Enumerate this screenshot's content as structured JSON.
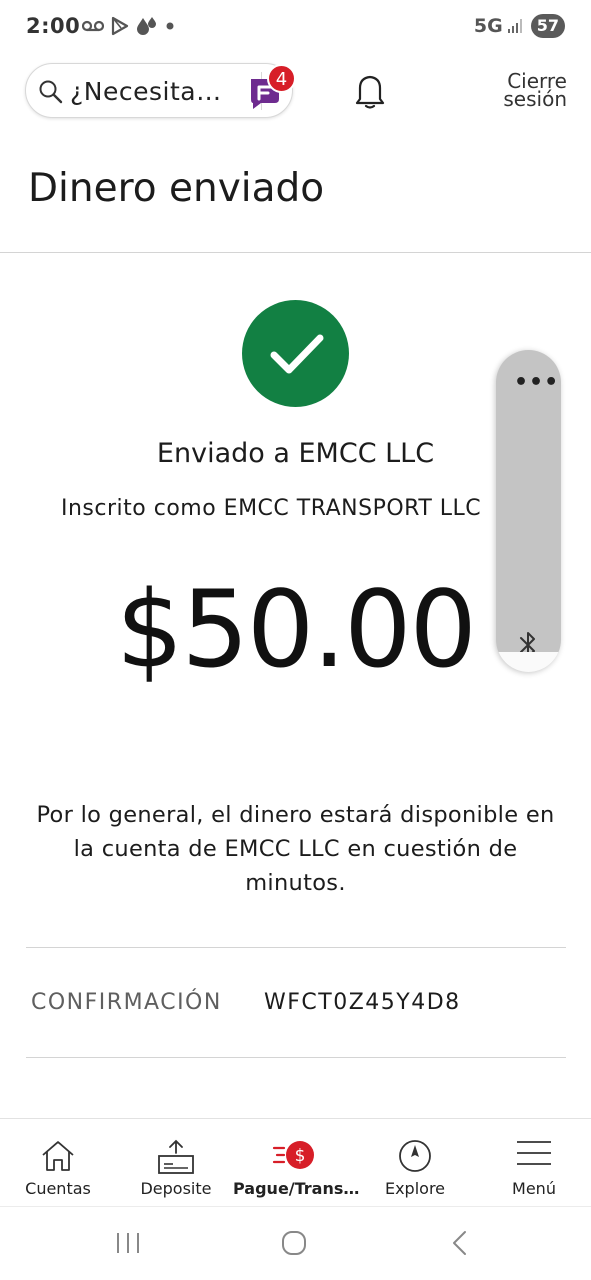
{
  "status_bar": {
    "time": "2:00",
    "network": "5G",
    "battery": "57"
  },
  "header": {
    "search_placeholder": "¿Necesita…",
    "chat_badge_count": "4",
    "signout_line1": "Cierre",
    "signout_line2": "sesión"
  },
  "page": {
    "title": "Dinero enviado"
  },
  "confirmation": {
    "sent_to": "Enviado a EMCC LLC",
    "enrolled_as": "Inscrito como EMCC TRANSPORT LLC",
    "amount": "$50.00",
    "availability_text": "Por lo general, el dinero estará disponible en la cuenta de EMCC LLC en cuestión de minutos.",
    "confirmation_label": "CONFIRMACIÓN",
    "confirmation_number": "WFCT0Z45Y4D8"
  },
  "side_panel": {
    "menu_glyph": "•••"
  },
  "bottom_nav": {
    "items": [
      {
        "label": "Cuentas",
        "icon": "home-icon"
      },
      {
        "label": "Deposite",
        "icon": "deposit-icon"
      },
      {
        "label": "Pague/Trans…",
        "icon": "pay-transfer-icon",
        "active": true
      },
      {
        "label": "Explore",
        "icon": "compass-icon"
      },
      {
        "label": "Menú",
        "icon": "hamburger-icon"
      }
    ]
  },
  "colors": {
    "success_green": "#128043",
    "brand_red": "#d71e28",
    "chat_purple": "#6e2b8f"
  }
}
